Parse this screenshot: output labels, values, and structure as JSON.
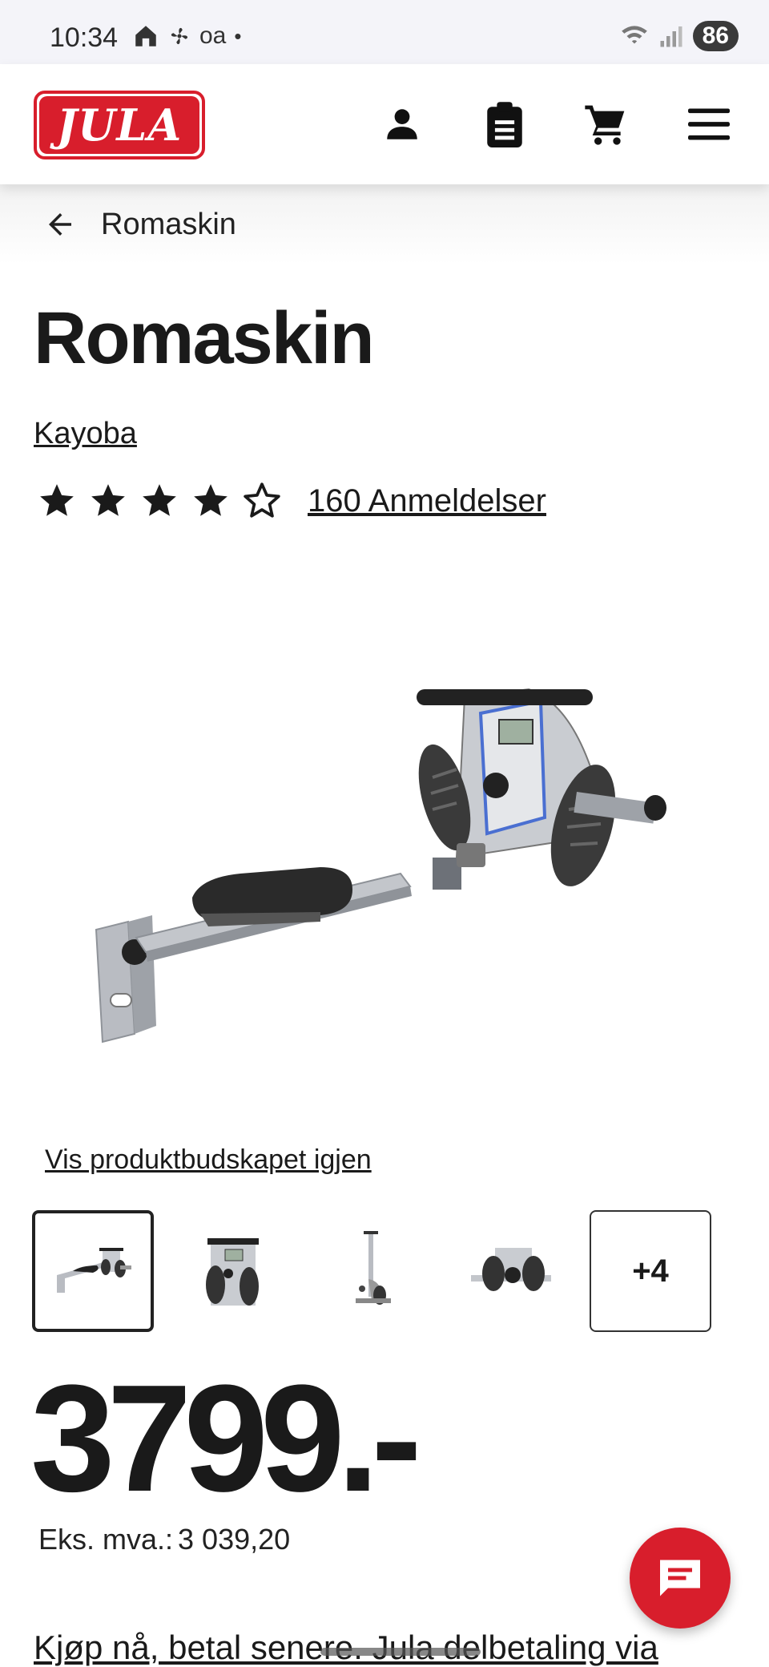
{
  "status_bar": {
    "time": "10:34",
    "notif_text": "oa",
    "battery": "86"
  },
  "header": {
    "logo_text": "JULA",
    "icons": [
      "user-icon",
      "clipboard-icon",
      "cart-icon",
      "menu-icon"
    ]
  },
  "breadcrumb": {
    "label": "Romaskin"
  },
  "product": {
    "title": "Romaskin",
    "brand": "Kayoba",
    "rating": 4.5,
    "reviews_label": "160 Anmeldelser",
    "show_message_link": "Vis produktbudskapet igjen",
    "more_images_label": "+4",
    "price": "3799.-",
    "vat_label": "Eks. mva.:",
    "vat_value": "3 039,20",
    "bnpl_text": "Kjøp nå, betal senere. Jula delbetaling via"
  },
  "colors": {
    "brand_red": "#d81e2c",
    "text": "#1a1a1a"
  }
}
